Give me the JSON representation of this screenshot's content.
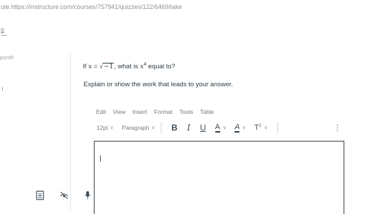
{
  "browser": {
    "url": "ute.https://instructure.com/courses/757941/quizzes/122/6469/take"
  },
  "sidebar": {
    "marker": "o",
    "label": "ponth"
  },
  "question": {
    "prefix": "If ",
    "var": "x",
    "equals": " = ",
    "radicand": "−1",
    "comma_text": ", what is ",
    "power_base": "x",
    "power_exp": "4",
    "suffix": " equal to?",
    "instruction": "Explain or show the work that leads to your answer."
  },
  "editor_menu": [
    "Edit",
    "View",
    "Insert",
    "Format",
    "Tools",
    "Table"
  ],
  "toolbar": {
    "font_size": "12pt",
    "block_format": "Paragraph",
    "bold": "B",
    "italic": "I",
    "underline": "U",
    "text_color": "A",
    "highlight": "A",
    "superscript_base": "T",
    "superscript_exp": "2",
    "more": "⋮"
  },
  "icons": [
    "document-icon",
    "hide-icon",
    "microphone-icon"
  ]
}
